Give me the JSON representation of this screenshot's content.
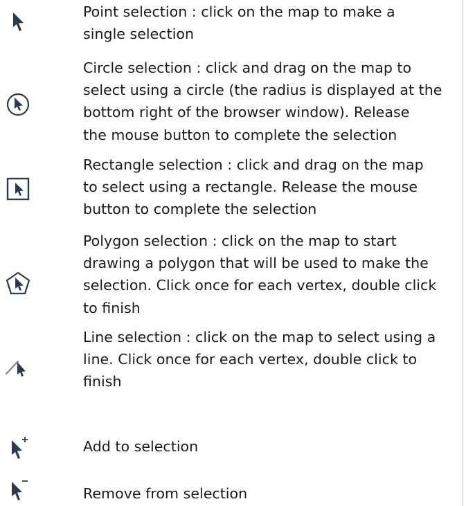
{
  "tools": [
    {
      "id": "point",
      "icon": "point-select-arrow-icon",
      "lines": [
        "Point selection : click on the map to make a",
        "single selection"
      ]
    },
    {
      "id": "circle",
      "icon": "circle-select-icon",
      "lines": [
        "Circle selection : click and drag on the map to",
        "select using a circle (the radius is displayed at the",
        "bottom right of the browser window). Release",
        "the mouse button to complete the selection"
      ]
    },
    {
      "id": "rectangle",
      "icon": "rectangle-select-icon",
      "lines": [
        "Rectangle selection : click and drag on the map",
        "to select using a rectangle. Release the mouse",
        "button to complete the selection"
      ]
    },
    {
      "id": "polygon",
      "icon": "polygon-select-icon",
      "lines": [
        "Polygon selection : click on the map to start",
        "drawing a polygon that will be used to make the",
        "selection. Click once for each vertex, double click",
        "to finish"
      ]
    },
    {
      "id": "line",
      "icon": "line-select-icon",
      "lines": [
        "Line selection : click on the map to select using a",
        "line. Click once for each vertex, double click to",
        "finish"
      ]
    },
    {
      "id": "add",
      "icon": "add-to-selection-icon",
      "lines": [
        "Add to selection"
      ]
    },
    {
      "id": "remove",
      "icon": "remove-from-selection-icon",
      "lines": [
        "Remove from selection"
      ]
    }
  ],
  "colors": {
    "icon_arrow": "#2d3a4d",
    "icon_frame": "#2d3a4d",
    "text": "#1a1a1a",
    "rule": "#b8b8b8"
  }
}
